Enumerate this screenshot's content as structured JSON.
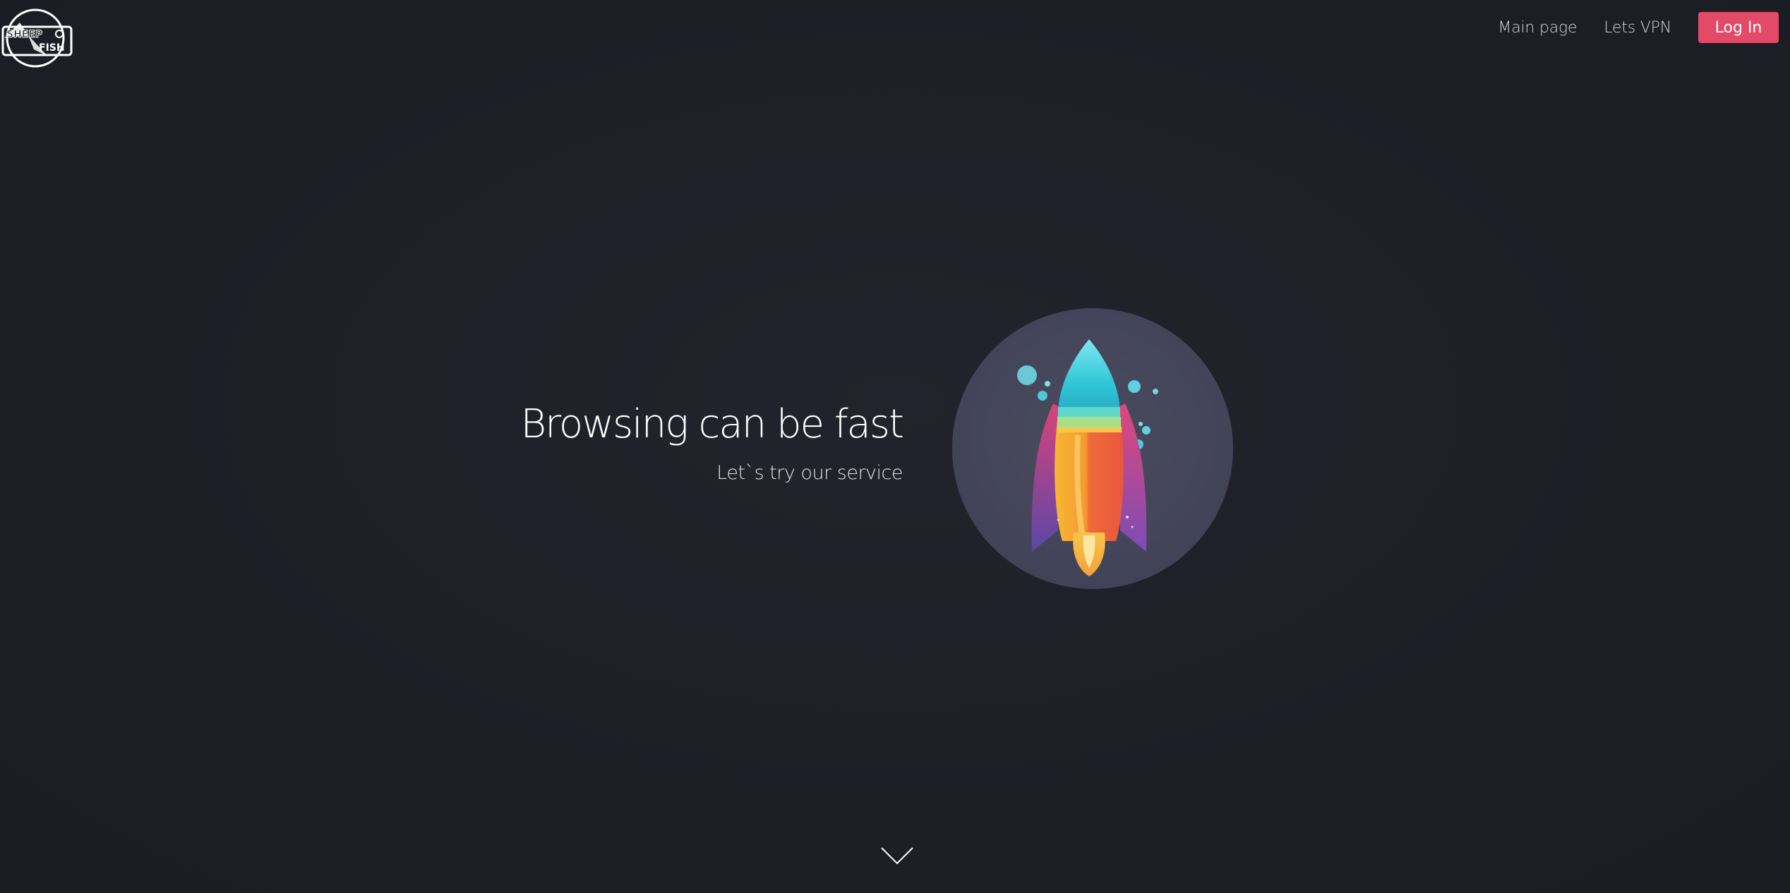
{
  "header": {
    "logo": {
      "icon": "sheep-fish-logo-icon",
      "text_top": "SHEEP",
      "text_bottom": "FISH"
    },
    "nav": {
      "main_page_label": "Main page",
      "lets_vpn_label": "Lets VPN",
      "login_label": "Log In"
    }
  },
  "hero": {
    "title": "Browsing can be fast",
    "subtitle": "Let`s try our service",
    "illustration_icon": "rocket-icon"
  },
  "scroll": {
    "icon": "chevron-down-icon"
  },
  "colors": {
    "background": "#1f1f28",
    "accent": "#e24a67",
    "circle": "#474859",
    "nav_text": "#d6d6dc"
  }
}
